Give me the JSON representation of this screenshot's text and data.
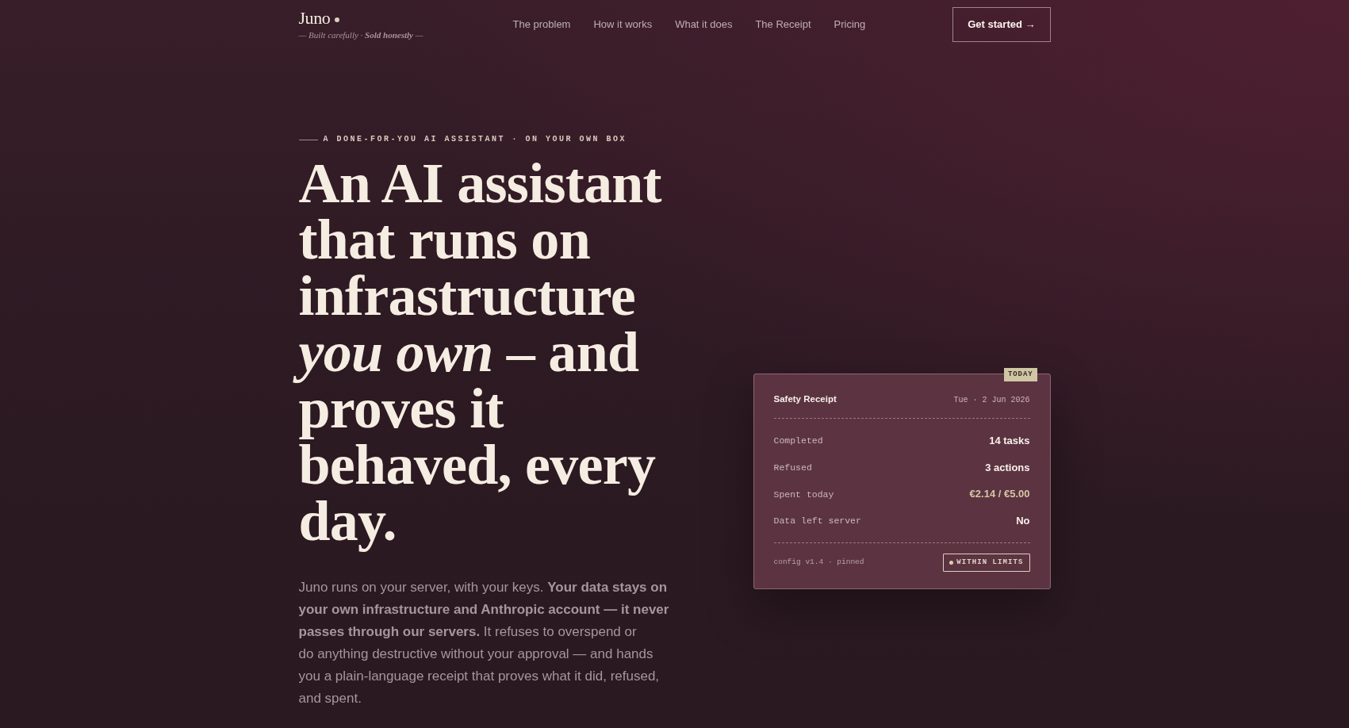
{
  "header": {
    "logo": {
      "name": "Juno",
      "tagline": "— Built carefully · **Sold honestly** —"
    },
    "nav": [
      {
        "label": "The problem"
      },
      {
        "label": "How it works"
      },
      {
        "label": "What it does"
      },
      {
        "label": "The Receipt"
      },
      {
        "label": "Pricing"
      }
    ],
    "cta": {
      "label": "Get started →"
    }
  },
  "hero": {
    "eyebrow": "A DONE-FOR-YOU AI ASSISTANT · ON YOUR OWN BOX",
    "headline": "An AI assistant that runs on infrastructure *you own* – and proves it behaved, every day.",
    "intro": "Juno runs on your server, with your keys. **Your data stays on your own infrastructure and Anthropic account — it never passes through our servers.** It refuses to overspend or do anything destructive without your approval — and hands you a plain-language receipt that proves what it did, refused, and spent."
  },
  "receipt": {
    "badge": "TODAY",
    "title": "Safety Receipt",
    "date": "Tue · 2 Jun 2026",
    "rows": [
      {
        "label": "Completed",
        "value": "14 tasks",
        "kind": "plain"
      },
      {
        "label": "Refused",
        "value": "3 actions",
        "kind": "plain"
      },
      {
        "label": "Spent today",
        "value": "€2.14 / €5.00",
        "kind": "amount"
      },
      {
        "label": "Data left server",
        "value": "No",
        "kind": "plain"
      }
    ],
    "config": "config v1.4 · pinned",
    "status": {
      "label": "WITHIN LIMITS"
    }
  }
}
